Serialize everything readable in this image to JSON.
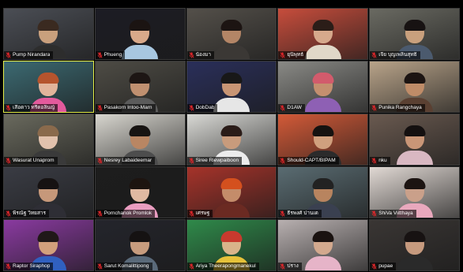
{
  "participants": [
    {
      "name": "Pump Nirandara",
      "bg": "#4b4e55",
      "skin": "#c9a07d",
      "hair": "#3a2a20",
      "shirt": "#2d2d2d",
      "muted": true
    },
    {
      "name": "Phueng",
      "bg": "#1c1c24",
      "skin": "#d9a98a",
      "hair": "#1b1412",
      "shirt": "#a8c7e0",
      "muted": true
    },
    {
      "name": "น้องมา",
      "bg": "#54504a",
      "skin": "#b38566",
      "hair": "#1c1412",
      "shirt": "#3b3835",
      "muted": true
    },
    {
      "name": "ยุนิพุทธ์",
      "bg": "#c74d3c",
      "skin": "#d6a98c",
      "hair": "#2b1d18",
      "shirt": "#e0d8c8",
      "muted": true
    },
    {
      "name": "เจีย บุญเพลินสุทธิ์",
      "bg": "#6a6a62",
      "skin": "#c9a07d",
      "hair": "#171212",
      "shirt": "#4b5a6e",
      "muted": true
    },
    {
      "name": "เสือดาว ทรีดอลินญ์",
      "bg": "#3c6a72",
      "skin": "#e2b49b",
      "hair": "#b5542d",
      "shirt": "#e35a9c",
      "muted": true,
      "active": true
    },
    {
      "name": "Pasakorn Intoo-Marn",
      "bg": "#4e4c45",
      "skin": "#c09070",
      "hair": "#1d1614",
      "shirt": "#5b5b5b",
      "muted": true
    },
    {
      "name": "DobDab",
      "bg": "#2a2f5a",
      "skin": "#c89574",
      "hair": "#181818",
      "shirt": "#e6e6e6",
      "muted": true
    },
    {
      "name": "D1AW",
      "bg": "#8a8a86",
      "skin": "#c48f6f",
      "hair": "#d25b6c",
      "shirt": "#8e60b4",
      "muted": true
    },
    {
      "name": "Punika Rangchaya",
      "bg": "#b9a48a",
      "skin": "#bf8c68",
      "hair": "#1c1412",
      "shirt": "#5a4032",
      "muted": true
    },
    {
      "name": "Wasurat Unaprom",
      "bg": "#6a6a5e",
      "skin": "#e2c2ad",
      "hair": "#8a6a4c",
      "shirt": "#3a3a3a",
      "muted": true
    },
    {
      "name": "Nesrey Labaideemar",
      "bg": "#d8d6cf",
      "skin": "#b98663",
      "hair": "#181412",
      "shirt": "#4d4d4d",
      "muted": true
    },
    {
      "name": "Siree Riewpaiboon",
      "bg": "#d9d9d5",
      "skin": "#c89b7c",
      "hair": "#2a1c18",
      "shirt": "#ececec",
      "muted": true
    },
    {
      "name": "Should-CAPT/BIPAM",
      "bg": "#d35a38",
      "skin": "#d0a07e",
      "hair": "#161210",
      "shirt": "#2b2b2b",
      "muted": true
    },
    {
      "name": "nku",
      "bg": "#6a5a50",
      "skin": "#c99677",
      "hair": "#141010",
      "shirt": "#d9b8c2",
      "muted": true
    },
    {
      "name": "พีรณัฐ วิทยสาร",
      "bg": "#3a3c44",
      "skin": "#c6987a",
      "hair": "#161212",
      "shirt": "#2e2e35",
      "muted": true
    },
    {
      "name": "Pornchanok Promlok",
      "bg": "#1d1d1d",
      "skin": "#e0b9a2",
      "hair": "#1d1410",
      "shirt": "#ea9dc0",
      "muted": true
    },
    {
      "name": "เศรษฐ",
      "bg": "#a6332a",
      "skin": "#c48c6a",
      "hair": "#d4501e",
      "shirt": "#6b2a22",
      "muted": true
    },
    {
      "name": "ธีรพงศ์ ปานเด",
      "bg": "#5a6c72",
      "skin": "#b8845f",
      "hair": "#222",
      "shirt": "#3a4050",
      "muted": true
    },
    {
      "name": "ShiVa Viitthaya",
      "bg": "#e1d9d4",
      "skin": "#caa08a",
      "hair": "#1c1412",
      "shirt": "#e9a8bd",
      "muted": true
    },
    {
      "name": "Raptor Siraphop",
      "bg": "#8a3aa0",
      "skin": "#d2a07c",
      "hair": "#201818",
      "shirt": "#3060c0",
      "muted": true
    },
    {
      "name": "Sarut Komalittipong",
      "bg": "#24252c",
      "skin": "#c79c7e",
      "hair": "#151212",
      "shirt": "#5a6a7a",
      "muted": true
    },
    {
      "name": "Ariya Theerapongmanekul",
      "bg": "#2f8a4a",
      "skin": "#d9b48a",
      "hair": "#c83a2e",
      "shirt": "#e6c23a",
      "muted": true
    },
    {
      "name": "ปราง",
      "bg": "#b8b0b0",
      "skin": "#d3a98e",
      "hair": "#1a1210",
      "shirt": "#e6b4c8",
      "muted": true
    },
    {
      "name": "pupae",
      "bg": "#3a3634",
      "skin": "#c69a7e",
      "hair": "#171212",
      "shirt": "#2a2a2a",
      "muted": true
    }
  ],
  "colors": {
    "mic_muted": "#e0262a",
    "active_border": "#e6ef4a",
    "background": "#000000"
  }
}
